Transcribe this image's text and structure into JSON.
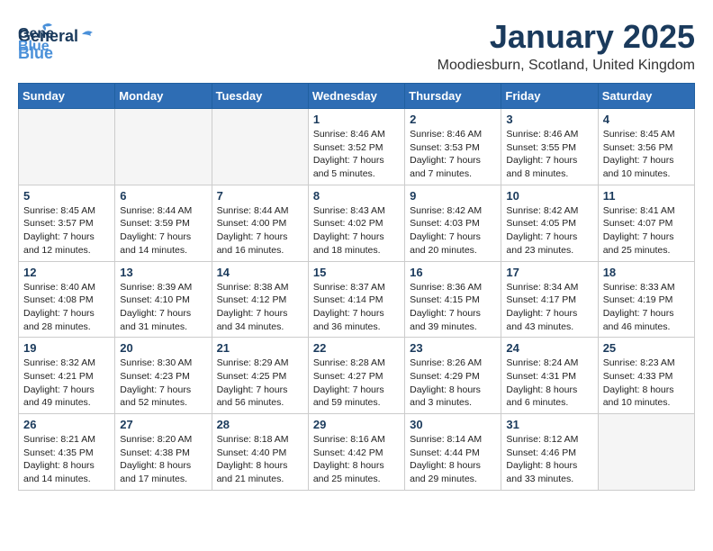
{
  "header": {
    "logo_line1": "General",
    "logo_line2": "Blue",
    "month": "January 2025",
    "location": "Moodiesburn, Scotland, United Kingdom"
  },
  "days_of_week": [
    "Sunday",
    "Monday",
    "Tuesday",
    "Wednesday",
    "Thursday",
    "Friday",
    "Saturday"
  ],
  "weeks": [
    [
      {
        "day": "",
        "info": ""
      },
      {
        "day": "",
        "info": ""
      },
      {
        "day": "",
        "info": ""
      },
      {
        "day": "1",
        "info": "Sunrise: 8:46 AM\nSunset: 3:52 PM\nDaylight: 7 hours\nand 5 minutes."
      },
      {
        "day": "2",
        "info": "Sunrise: 8:46 AM\nSunset: 3:53 PM\nDaylight: 7 hours\nand 7 minutes."
      },
      {
        "day": "3",
        "info": "Sunrise: 8:46 AM\nSunset: 3:55 PM\nDaylight: 7 hours\nand 8 minutes."
      },
      {
        "day": "4",
        "info": "Sunrise: 8:45 AM\nSunset: 3:56 PM\nDaylight: 7 hours\nand 10 minutes."
      }
    ],
    [
      {
        "day": "5",
        "info": "Sunrise: 8:45 AM\nSunset: 3:57 PM\nDaylight: 7 hours\nand 12 minutes."
      },
      {
        "day": "6",
        "info": "Sunrise: 8:44 AM\nSunset: 3:59 PM\nDaylight: 7 hours\nand 14 minutes."
      },
      {
        "day": "7",
        "info": "Sunrise: 8:44 AM\nSunset: 4:00 PM\nDaylight: 7 hours\nand 16 minutes."
      },
      {
        "day": "8",
        "info": "Sunrise: 8:43 AM\nSunset: 4:02 PM\nDaylight: 7 hours\nand 18 minutes."
      },
      {
        "day": "9",
        "info": "Sunrise: 8:42 AM\nSunset: 4:03 PM\nDaylight: 7 hours\nand 20 minutes."
      },
      {
        "day": "10",
        "info": "Sunrise: 8:42 AM\nSunset: 4:05 PM\nDaylight: 7 hours\nand 23 minutes."
      },
      {
        "day": "11",
        "info": "Sunrise: 8:41 AM\nSunset: 4:07 PM\nDaylight: 7 hours\nand 25 minutes."
      }
    ],
    [
      {
        "day": "12",
        "info": "Sunrise: 8:40 AM\nSunset: 4:08 PM\nDaylight: 7 hours\nand 28 minutes."
      },
      {
        "day": "13",
        "info": "Sunrise: 8:39 AM\nSunset: 4:10 PM\nDaylight: 7 hours\nand 31 minutes."
      },
      {
        "day": "14",
        "info": "Sunrise: 8:38 AM\nSunset: 4:12 PM\nDaylight: 7 hours\nand 34 minutes."
      },
      {
        "day": "15",
        "info": "Sunrise: 8:37 AM\nSunset: 4:14 PM\nDaylight: 7 hours\nand 36 minutes."
      },
      {
        "day": "16",
        "info": "Sunrise: 8:36 AM\nSunset: 4:15 PM\nDaylight: 7 hours\nand 39 minutes."
      },
      {
        "day": "17",
        "info": "Sunrise: 8:34 AM\nSunset: 4:17 PM\nDaylight: 7 hours\nand 43 minutes."
      },
      {
        "day": "18",
        "info": "Sunrise: 8:33 AM\nSunset: 4:19 PM\nDaylight: 7 hours\nand 46 minutes."
      }
    ],
    [
      {
        "day": "19",
        "info": "Sunrise: 8:32 AM\nSunset: 4:21 PM\nDaylight: 7 hours\nand 49 minutes."
      },
      {
        "day": "20",
        "info": "Sunrise: 8:30 AM\nSunset: 4:23 PM\nDaylight: 7 hours\nand 52 minutes."
      },
      {
        "day": "21",
        "info": "Sunrise: 8:29 AM\nSunset: 4:25 PM\nDaylight: 7 hours\nand 56 minutes."
      },
      {
        "day": "22",
        "info": "Sunrise: 8:28 AM\nSunset: 4:27 PM\nDaylight: 7 hours\nand 59 minutes."
      },
      {
        "day": "23",
        "info": "Sunrise: 8:26 AM\nSunset: 4:29 PM\nDaylight: 8 hours\nand 3 minutes."
      },
      {
        "day": "24",
        "info": "Sunrise: 8:24 AM\nSunset: 4:31 PM\nDaylight: 8 hours\nand 6 minutes."
      },
      {
        "day": "25",
        "info": "Sunrise: 8:23 AM\nSunset: 4:33 PM\nDaylight: 8 hours\nand 10 minutes."
      }
    ],
    [
      {
        "day": "26",
        "info": "Sunrise: 8:21 AM\nSunset: 4:35 PM\nDaylight: 8 hours\nand 14 minutes."
      },
      {
        "day": "27",
        "info": "Sunrise: 8:20 AM\nSunset: 4:38 PM\nDaylight: 8 hours\nand 17 minutes."
      },
      {
        "day": "28",
        "info": "Sunrise: 8:18 AM\nSunset: 4:40 PM\nDaylight: 8 hours\nand 21 minutes."
      },
      {
        "day": "29",
        "info": "Sunrise: 8:16 AM\nSunset: 4:42 PM\nDaylight: 8 hours\nand 25 minutes."
      },
      {
        "day": "30",
        "info": "Sunrise: 8:14 AM\nSunset: 4:44 PM\nDaylight: 8 hours\nand 29 minutes."
      },
      {
        "day": "31",
        "info": "Sunrise: 8:12 AM\nSunset: 4:46 PM\nDaylight: 8 hours\nand 33 minutes."
      },
      {
        "day": "",
        "info": ""
      }
    ]
  ]
}
